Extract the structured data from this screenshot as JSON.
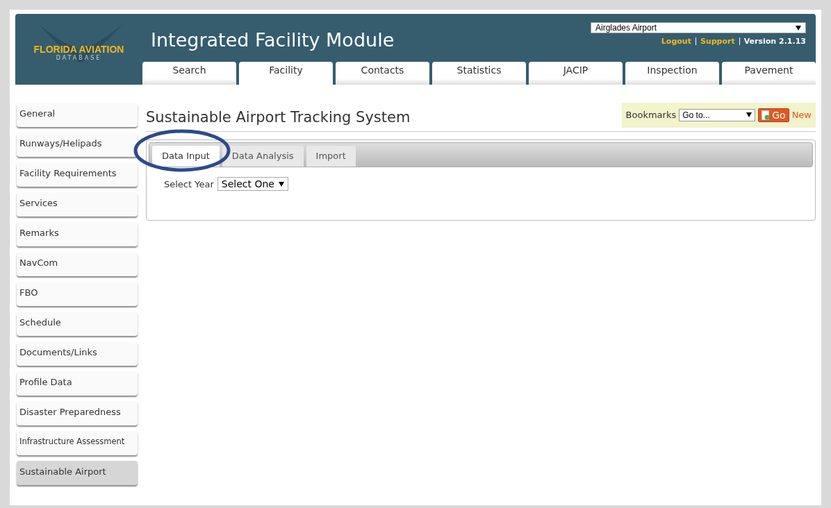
{
  "header": {
    "logo_title": "FLORIDA AVIATION",
    "logo_subtitle": "DATABASE",
    "title": "Integrated Facility Module",
    "airport_select": {
      "value": "Airglades Airport"
    },
    "links": [
      {
        "label": "Logout",
        "kind": "link"
      },
      {
        "label": "Support",
        "kind": "link"
      },
      {
        "label": "Version 2.1.13",
        "kind": "text"
      }
    ]
  },
  "main_tabs": [
    {
      "label": "Search",
      "selected": false
    },
    {
      "label": "Facility",
      "selected": true
    },
    {
      "label": "Contacts",
      "selected": false
    },
    {
      "label": "Statistics",
      "selected": false
    },
    {
      "label": "JACIP",
      "selected": false
    },
    {
      "label": "Inspection",
      "selected": false
    },
    {
      "label": "Pavement",
      "selected": false
    }
  ],
  "sidebar": {
    "items": [
      {
        "label": "General",
        "selected": false
      },
      {
        "label": "Runways/Helipads",
        "selected": false
      },
      {
        "label": "Facility Requirements",
        "selected": false
      },
      {
        "label": "Services",
        "selected": false
      },
      {
        "label": "Remarks",
        "selected": false
      },
      {
        "label": "NavCom",
        "selected": false
      },
      {
        "label": "FBO",
        "selected": false
      },
      {
        "label": "Schedule",
        "selected": false
      },
      {
        "label": "Documents/Links",
        "selected": false
      },
      {
        "label": "Profile Data",
        "selected": false
      },
      {
        "label": "Disaster Preparedness",
        "selected": false
      },
      {
        "label": "Infrastructure Assessment",
        "selected": false
      },
      {
        "label": "Sustainable Airport",
        "selected": true
      }
    ]
  },
  "page_title": "Sustainable Airport Tracking System",
  "bookmarks": {
    "label": "Bookmarks",
    "select_value": "Go to...",
    "go_button": "Go",
    "new_link": "New"
  },
  "sub_tabs": [
    {
      "label": "Data Input",
      "selected": true
    },
    {
      "label": "Data Analysis",
      "selected": false
    },
    {
      "label": "Import",
      "selected": false
    }
  ],
  "form": {
    "year_label": "Select Year",
    "year_value": "Select One"
  }
}
